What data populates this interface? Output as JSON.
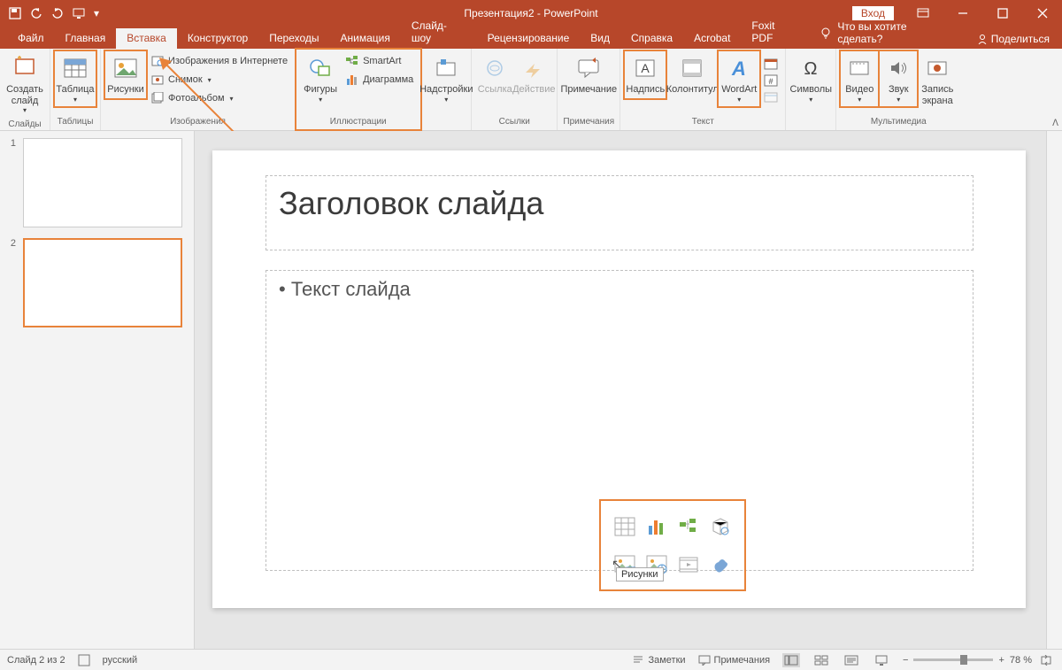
{
  "titlebar": {
    "title": "Презентация2 - PowerPoint",
    "login": "Вход"
  },
  "tabs": {
    "file": "Файл",
    "home": "Главная",
    "insert": "Вставка",
    "design": "Конструктор",
    "transitions": "Переходы",
    "animations": "Анимация",
    "slideshow": "Слайд-шоу",
    "review": "Рецензирование",
    "view": "Вид",
    "help": "Справка",
    "acrobat": "Acrobat",
    "foxit": "Foxit PDF",
    "tellme": "Что вы хотите сделать?",
    "share": "Поделиться"
  },
  "ribbon": {
    "slides": {
      "new_slide": "Создать слайд",
      "label": "Слайды"
    },
    "tables": {
      "table": "Таблица",
      "label": "Таблицы"
    },
    "images": {
      "pictures": "Рисунки",
      "online": "Изображения в Интернете",
      "screenshot": "Снимок",
      "album": "Фотоальбом",
      "label": "Изображения"
    },
    "illustrations": {
      "shapes": "Фигуры",
      "smartart": "SmartArt",
      "chart": "Диаграмма",
      "label": "Иллюстрации"
    },
    "addins": {
      "addins": "Надстройки",
      "label": ""
    },
    "links": {
      "link": "Ссылка",
      "action": "Действие",
      "label": "Ссылки"
    },
    "comments": {
      "comment": "Примечание",
      "label": "Примечания"
    },
    "text": {
      "textbox": "Надпись",
      "headerfooter": "Колонтитул",
      "wordart": "WordArt",
      "label": "Текст"
    },
    "symbols": {
      "symbols": "Символы",
      "label": ""
    },
    "media": {
      "video": "Видео",
      "audio": "Звук",
      "recording": "Запись экрана",
      "label": "Мультимедиа"
    }
  },
  "thumbs": {
    "n1": "1",
    "n2": "2"
  },
  "slide": {
    "title": "Заголовок слайда",
    "body": "Текст слайда",
    "tooltip": "Рисунки"
  },
  "status": {
    "slide": "Слайд 2 из 2",
    "lang": "русский",
    "notes": "Заметки",
    "comments": "Примечания",
    "zoom": "78 %"
  }
}
